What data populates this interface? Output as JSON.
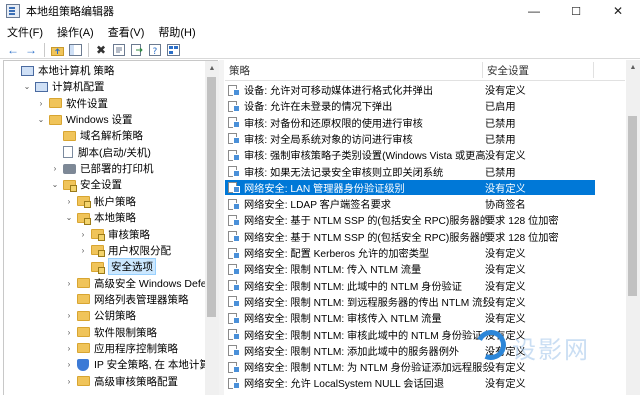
{
  "window": {
    "title": "本地组策略编辑器",
    "controls": {
      "minimize": "—",
      "maximize": "☐",
      "close": "✕"
    }
  },
  "menu": {
    "file": "文件(F)",
    "action": "操作(A)",
    "view": "查看(V)",
    "help": "帮助(H)"
  },
  "toolbar": {
    "back": "←",
    "forward": "→",
    "up": "up-folder-icon",
    "tree": "show-tree-icon",
    "delete": "✖",
    "properties": "properties-icon",
    "export": "export-icon",
    "help": "?",
    "view": "view-icon"
  },
  "tree": {
    "items": [
      {
        "label": "本地计算机 策略",
        "indent": 0,
        "icon": "computer-policy-icon",
        "toggle": ""
      },
      {
        "label": "计算机配置",
        "indent": 1,
        "icon": "computer-icon",
        "toggle": "⌄"
      },
      {
        "label": "软件设置",
        "indent": 2,
        "icon": "folder-icon",
        "toggle": "›"
      },
      {
        "label": "Windows 设置",
        "indent": 2,
        "icon": "folder-icon",
        "toggle": "⌄"
      },
      {
        "label": "域名解析策略",
        "indent": 3,
        "icon": "folder-icon",
        "toggle": ""
      },
      {
        "label": "脚本(启动/关机)",
        "indent": 3,
        "icon": "script-icon",
        "toggle": ""
      },
      {
        "label": "已部署的打印机",
        "indent": 3,
        "icon": "printer-icon",
        "toggle": "›"
      },
      {
        "label": "安全设置",
        "indent": 3,
        "icon": "lock-folder-icon",
        "toggle": "⌄"
      },
      {
        "label": "帐户策略",
        "indent": 4,
        "icon": "lock-folder-icon",
        "toggle": "›"
      },
      {
        "label": "本地策略",
        "indent": 4,
        "icon": "lock-folder-icon",
        "toggle": "⌄"
      },
      {
        "label": "审核策略",
        "indent": 5,
        "icon": "lock-folder-icon",
        "toggle": "›"
      },
      {
        "label": "用户权限分配",
        "indent": 5,
        "icon": "lock-folder-icon",
        "toggle": "›"
      },
      {
        "label": "安全选项",
        "indent": 5,
        "icon": "lock-folder-icon",
        "toggle": "",
        "selected": true
      },
      {
        "label": "高级安全 Windows Defender 防",
        "indent": 4,
        "icon": "folder-icon",
        "toggle": "›"
      },
      {
        "label": "网络列表管理器策略",
        "indent": 4,
        "icon": "folder-icon",
        "toggle": ""
      },
      {
        "label": "公钥策略",
        "indent": 4,
        "icon": "folder-icon",
        "toggle": "›"
      },
      {
        "label": "软件限制策略",
        "indent": 4,
        "icon": "folder-icon",
        "toggle": "›"
      },
      {
        "label": "应用程序控制策略",
        "indent": 4,
        "icon": "folder-icon",
        "toggle": "›"
      },
      {
        "label": "IP 安全策略, 在 本地计算机",
        "indent": 4,
        "icon": "shield-icon",
        "toggle": "›"
      },
      {
        "label": "高级审核策略配置",
        "indent": 4,
        "icon": "folder-icon",
        "toggle": "›"
      }
    ]
  },
  "list": {
    "columns": {
      "policy": "策略",
      "setting": "安全设置"
    },
    "rows": [
      {
        "policy": "设备: 允许对可移动媒体进行格式化并弹出",
        "setting": "没有定义"
      },
      {
        "policy": "设备: 允许在未登录的情况下弹出",
        "setting": "已启用"
      },
      {
        "policy": "审核: 对备份和还原权限的使用进行审核",
        "setting": "已禁用"
      },
      {
        "policy": "审核: 对全局系统对象的访问进行审核",
        "setting": "已禁用"
      },
      {
        "policy": "审核: 强制审核策略子类别设置(Windows Vista 或更高版本...",
        "setting": "没有定义"
      },
      {
        "policy": "审核: 如果无法记录安全审核则立即关闭系统",
        "setting": "已禁用"
      },
      {
        "policy": "网络安全: LAN 管理器身份验证级别",
        "setting": "没有定义",
        "selected": true
      },
      {
        "policy": "网络安全: LDAP 客户端签名要求",
        "setting": "协商签名"
      },
      {
        "policy": "网络安全: 基于 NTLM SSP 的(包括安全 RPC)服务器的最小...",
        "setting": "要求 128 位加密"
      },
      {
        "policy": "网络安全: 基于 NTLM SSP 的(包括安全 RPC)服务器的最小...",
        "setting": "要求 128 位加密"
      },
      {
        "policy": "网络安全: 配置 Kerberos 允许的加密类型",
        "setting": "没有定义"
      },
      {
        "policy": "网络安全: 限制 NTLM: 传入 NTLM 流量",
        "setting": "没有定义"
      },
      {
        "policy": "网络安全: 限制 NTLM: 此域中的 NTLM 身份验证",
        "setting": "没有定义"
      },
      {
        "policy": "网络安全: 限制 NTLM: 到远程服务器的传出 NTLM 流量",
        "setting": "没有定义"
      },
      {
        "policy": "网络安全: 限制 NTLM: 审核传入 NTLM 流量",
        "setting": "没有定义"
      },
      {
        "policy": "网络安全: 限制 NTLM: 审核此域中的 NTLM 身份验证",
        "setting": "没有定义"
      },
      {
        "policy": "网络安全: 限制 NTLM: 添加此域中的服务器例外",
        "setting": "没有定义"
      },
      {
        "policy": "网络安全: 限制 NTLM: 为 NTLM 身份验证添加远程服务器...",
        "setting": "没有定义"
      },
      {
        "policy": "网络安全: 允许 LocalSystem NULL 会话回退",
        "setting": "没有定义"
      }
    ]
  },
  "watermark": {
    "text": "设影网"
  }
}
